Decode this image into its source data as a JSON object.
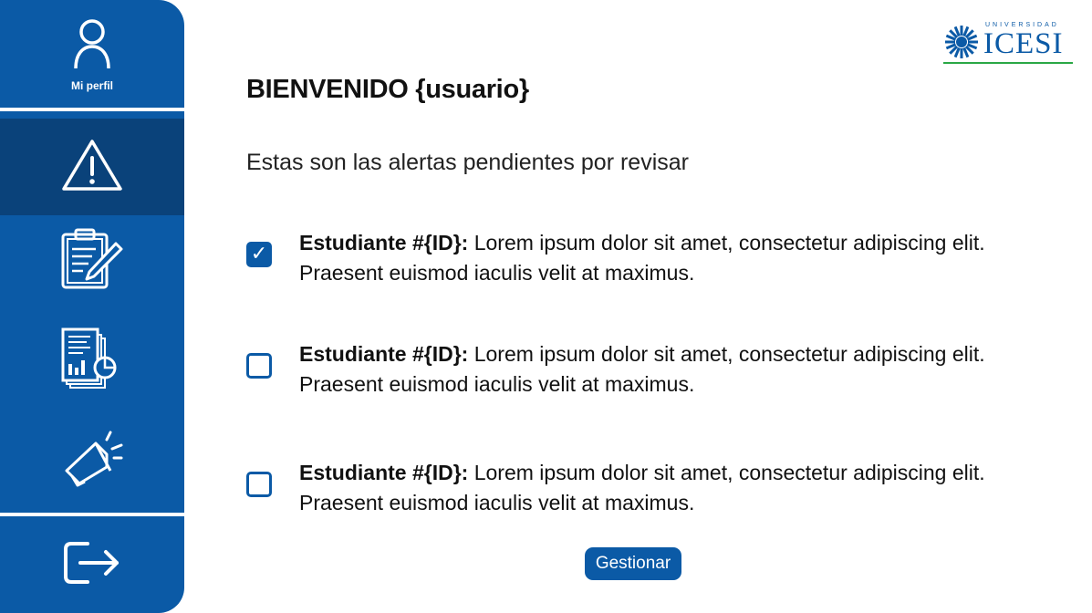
{
  "sidebar": {
    "profile_label": "Mi perfil",
    "items": [
      {
        "icon": "user-icon",
        "label": "Mi perfil"
      },
      {
        "icon": "warning-icon",
        "active": true
      },
      {
        "icon": "clipboard-edit-icon"
      },
      {
        "icon": "report-chart-icon"
      },
      {
        "icon": "megaphone-icon"
      },
      {
        "icon": "logout-icon"
      }
    ]
  },
  "logo": {
    "top_text": "UNIVERSIDAD",
    "main_text": "ICESI"
  },
  "main": {
    "title": "BIENVENIDO {usuario}",
    "subtitle": "Estas son las alertas pendientes por revisar",
    "alerts": [
      {
        "checked": true,
        "student": "Estudiante #{ID}:",
        "text": " Lorem ipsum dolor sit amet, consectetur adipiscing elit. Praesent euismod iaculis velit at maximus."
      },
      {
        "checked": false,
        "student": "Estudiante #{ID}:",
        "text": " Lorem ipsum dolor sit amet, consectetur adipiscing elit. Praesent euismod iaculis velit at maximus."
      },
      {
        "checked": false,
        "student": "Estudiante #{ID}:",
        "text": " Lorem ipsum dolor sit amet, consectetur adipiscing elit. Praesent euismod iaculis velit at maximus."
      }
    ],
    "manage_button": "Gestionar"
  },
  "colors": {
    "primary": "#0b5aa6",
    "active": "#0a427a",
    "accent_green": "#2aa845",
    "background": "#ffffff"
  }
}
